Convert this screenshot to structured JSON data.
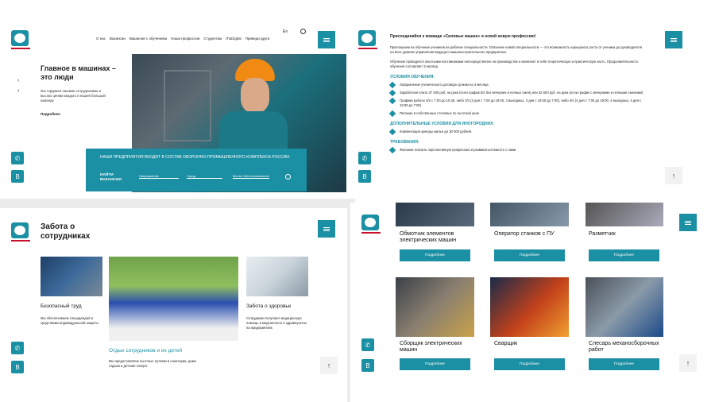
{
  "panel1": {
    "nav": [
      "О нас",
      "Вакансии",
      "Вакансии с обучением",
      "Наши профессии",
      "Студентам",
      "IT&Digital",
      "Приведи друга"
    ],
    "lang": "En",
    "hero_title": "Главное в машинах – это люди",
    "hero_text": "Мы гордимся нашими сотрудниками и высоко ценим каждого в нашей большой команде",
    "more_link": "Подробнее",
    "band_text": "НАШИ ПРЕДПРИЯТИЯ ВХОДЯТ В СОСТАВ ОБОРОННО-ПРОМЫШЛЕННОГО КОМПЛЕКСА РОССИИ.",
    "find_label": "НАЙТИ ВАКАНСИИ",
    "filters": [
      "Направление",
      "Город",
      "Места/ Местоположение"
    ]
  },
  "panel2": {
    "heading": "Присоединяйся к команде «Силовых машин» и освой новую профессию!",
    "intro1": "Приглашаем на обучение учеников на рабочие специальности. Освоение новой специальности — это возможность карьерного роста от ученика до руководителя на всех уровнях управления ведущего машиностроительного предприятия.",
    "intro2": "Обучение проводится опытными наставниками непосредственно на производстве и включает в себя теоретическую и практическую часть. Продолжительность обучения составляет 3 месяца.",
    "conditions_title": "УСЛОВИЯ ОБУЧЕНИЯ:",
    "conditions": [
      "Оформление ученического договора сроком на 3 месяца",
      "Заработная плата 37 400 руб. на руки (если график 5/2 без вечерних и ночных смен) или 42 600 руб. на руки (если график с вечерними и ночными сменами)",
      "Графики работы 5/2 с 7:00 до 15:35, либо 3/3 (3 дня с 7:00 до 19:00, 3 выходных, 3 дня с 19:00 до 7:00), либо 4/4 (4 дня с 7:00 до 19:00, 4 выходных, 4 дня с 19:00 до 7:00)",
      "Питание в собственных столовых по льготной цене"
    ],
    "extra_title": "ДОПОЛНИТЕЛЬНЫЕ УСЛОВИЯ ДЛЯ ИНОГОРОДНИХ:",
    "extra": [
      "Компенсация аренды жилья до 30 000 рублей."
    ],
    "req_title": "ТРЕБОВАНИЯ:",
    "req": [
      "Желание освоить перспективную профессию и развиваться вместе с нами"
    ]
  },
  "panel3": {
    "title": "Забота о сотрудниках",
    "card1_title": "Безопасный труд",
    "card1_text": "Мы обеспечиваем спецодеждой и средствами индивидуальной защиты.",
    "card2_title": "Отдых сотрудников и их детей",
    "card2_text": "Мы предоставляем льготные путевки в санатории, дома отдыха и детские лагеря.",
    "card3_title": "Забота о здоровье",
    "card3_text": "Сотрудники получают медицинскую помощь в медсанчасти и здравпунктах на предприятиях"
  },
  "panel4": {
    "jobs": [
      "Обмотчик элементов электрических машин",
      "Оператор станков с ПУ",
      "Разметчик",
      "Сборщик электрических машин",
      "Сварщик",
      "Слесарь механосборочных работ"
    ],
    "button_label": "Подробнее"
  },
  "colors": {
    "accent": "#1b8fa3",
    "brand_red": "#c8102e"
  }
}
